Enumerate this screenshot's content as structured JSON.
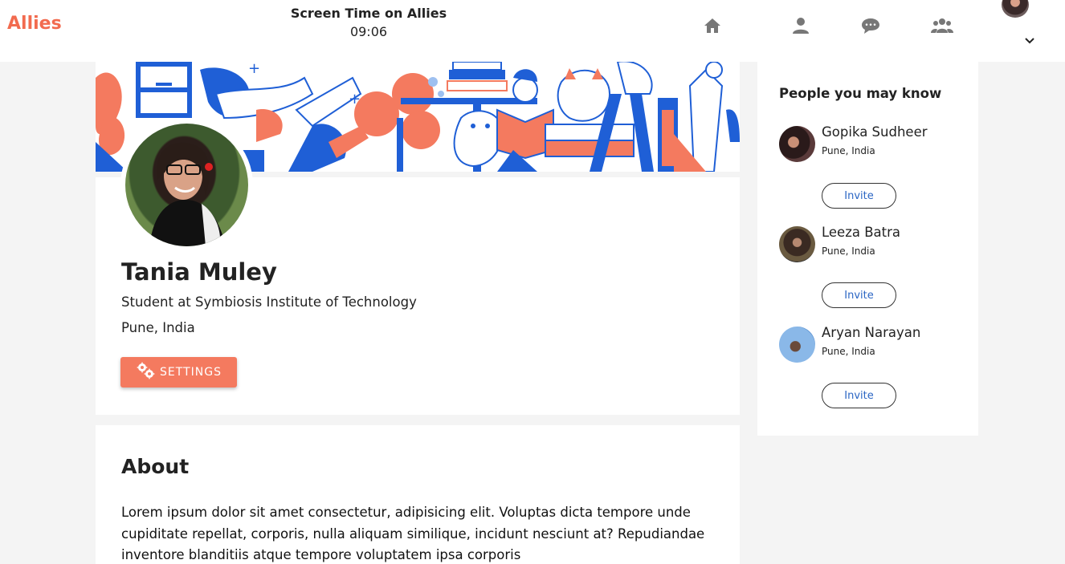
{
  "app": {
    "logo": "Allies"
  },
  "screen_time": {
    "label": "Screen Time on Allies",
    "value": "09:06"
  },
  "nav": [
    {
      "icon": "home-icon"
    },
    {
      "icon": "user-icon"
    },
    {
      "icon": "chat-icon"
    },
    {
      "icon": "group-icon"
    }
  ],
  "profile": {
    "name": "Tania Muley",
    "headline": "Student at Symbiosis Institute of Technology",
    "location": "Pune, India",
    "settings_label": "SETTINGS"
  },
  "about": {
    "title": "About",
    "text": "Lorem ipsum dolor sit amet consectetur, adipisicing elit. Voluptas dicta tempore unde cupiditate repellat, corporis, nulla aliquam similique, incidunt nesciunt at? Repudiandae inventore blanditiis atque tempore voluptatem ipsa corporis"
  },
  "pymk": {
    "title": "People you may know",
    "people": [
      {
        "name": "Gopika Sudheer",
        "location": "Pune, India",
        "invite": "Invite"
      },
      {
        "name": "Leeza Batra",
        "location": "Pune, India",
        "invite": "Invite"
      },
      {
        "name": "Aryan Narayan",
        "location": "Pune, India",
        "invite": "Invite"
      }
    ]
  },
  "colors": {
    "accent": "#f26b4f",
    "button": "#f47a5f",
    "link": "#2b66c4",
    "illustration_blue": "#1f5fd6"
  }
}
